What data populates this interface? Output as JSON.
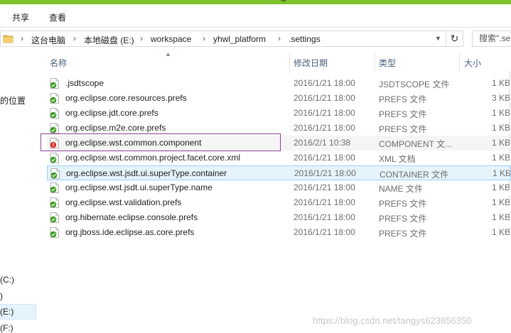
{
  "ribbon": {
    "tabs": [
      "共享",
      "查看"
    ]
  },
  "address": {
    "crumbs": [
      "这台电脑",
      "本地磁盘 (E:)",
      "workspace",
      "yhwl_platform",
      ".settings"
    ],
    "search_placeholder": "搜索\".se"
  },
  "nav": {
    "items": [
      "的位置",
      "(C:)",
      ")",
      "(E:)",
      "(F:)"
    ]
  },
  "columns": {
    "name": "名称",
    "date": "修改日期",
    "type": "类型",
    "size": "大小"
  },
  "files": [
    {
      "name": ".jsdtscope",
      "date": "2016/1/21 18:00",
      "type": "JSDTSCOPE 文件",
      "size": "1 KB",
      "status": "ok"
    },
    {
      "name": "org.eclipse.core.resources.prefs",
      "date": "2016/1/21 18:00",
      "type": "PREFS 文件",
      "size": "3 KB",
      "status": "ok"
    },
    {
      "name": "org.eclipse.jdt.core.prefs",
      "date": "2016/1/21 18:00",
      "type": "PREFS 文件",
      "size": "1 KB",
      "status": "ok"
    },
    {
      "name": "org.eclipse.m2e.core.prefs",
      "date": "2016/1/21 18:00",
      "type": "PREFS 文件",
      "size": "1 KB",
      "status": "ok"
    },
    {
      "name": "org.eclipse.wst.common.component",
      "date": "2016/2/1 10:38",
      "type": "COMPONENT 文...",
      "size": "1 KB",
      "status": "conflict"
    },
    {
      "name": "org.eclipse.wst.common.project.facet.core.xml",
      "date": "2016/1/21 18:00",
      "type": "XML 文档",
      "size": "1 KB",
      "status": "ok"
    },
    {
      "name": "org.eclipse.wst.jsdt.ui.superType.container",
      "date": "2016/1/21 18:00",
      "type": "CONTAINER 文件",
      "size": "1 KB",
      "status": "ok"
    },
    {
      "name": "org.eclipse.wst.jsdt.ui.superType.name",
      "date": "2016/1/21 18:00",
      "type": "NAME 文件",
      "size": "1 KB",
      "status": "ok"
    },
    {
      "name": "org.eclipse.wst.validation.prefs",
      "date": "2016/1/21 18:00",
      "type": "PREFS 文件",
      "size": "1 KB",
      "status": "ok"
    },
    {
      "name": "org.hibernate.eclipse.console.prefs",
      "date": "2016/1/21 18:00",
      "type": "PREFS 文件",
      "size": "1 KB",
      "status": "ok"
    },
    {
      "name": "org.jboss.ide.eclipse.as.core.prefs",
      "date": "2016/1/21 18:00",
      "type": "PREFS 文件",
      "size": "1 KB",
      "status": "ok"
    }
  ],
  "watermark": "https://blog.csdn.net/tangys623656350",
  "colors": {
    "accent_green": "#7ec22b",
    "selection": "#e5f3fb",
    "highlight_border": "#8e3f96",
    "conflict_red": "#d93025",
    "ok_green": "#3a9b1f"
  }
}
